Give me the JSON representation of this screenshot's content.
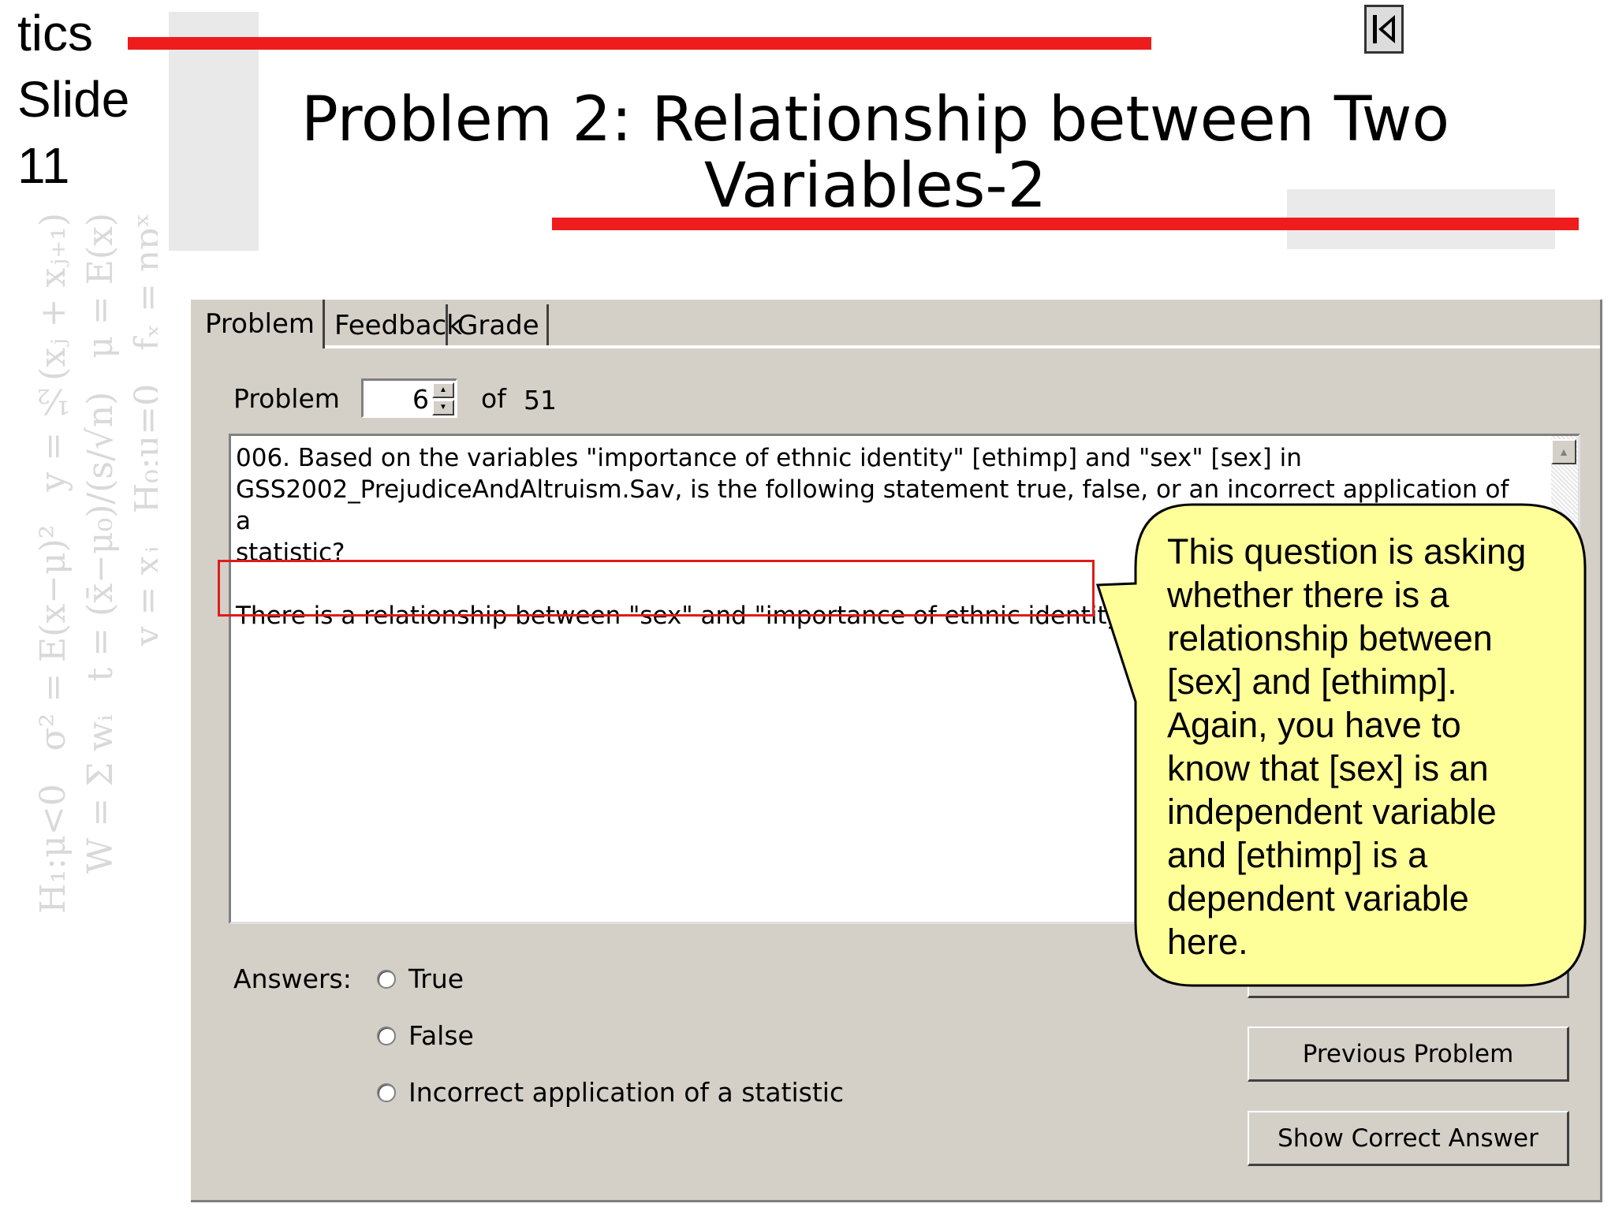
{
  "slide": {
    "side_title_lines": [
      "tics",
      "Slide",
      "11"
    ],
    "title_line1": "Problem 2: Relationship between Two",
    "title_line2": "Variables-2",
    "colors": {
      "accent_red": "#ee1c1c",
      "callout_fill": "#ffff99"
    },
    "nav_icon": "first-slide-icon"
  },
  "tabs": [
    {
      "label": "Problem",
      "active": true
    },
    {
      "label": "Feedback",
      "active": false
    },
    {
      "label": "Grade",
      "active": false
    }
  ],
  "problem_selector": {
    "label": "Problem",
    "value": "6",
    "of_label": "of",
    "total": "51"
  },
  "question": {
    "line1": "006. Based on the variables \"importance of ethnic identity\" [ethimp] and \"sex\" [sex] in",
    "line2": "GSS2002_PrejudiceAndAltruism.Sav, is the following statement true, false, or an incorrect application of a",
    "line3": "statistic?",
    "statement": "There is a relationship between \"sex\" and \"importance of ethnic identity\"."
  },
  "answers": {
    "label": "Answers:",
    "options": [
      "True",
      "False",
      "Incorrect application of a statistic"
    ]
  },
  "buttons": {
    "previous": "Previous Problem",
    "show_answer": "Show Correct Answer"
  },
  "callout": {
    "lines": [
      "This question is asking",
      "whether there is a",
      "relationship between",
      "[sex] and [ethimp].",
      "Again, you have to",
      "know that [sex] is an",
      "independent variable",
      "and [ethimp] is a",
      "dependent variable",
      "here."
    ]
  }
}
